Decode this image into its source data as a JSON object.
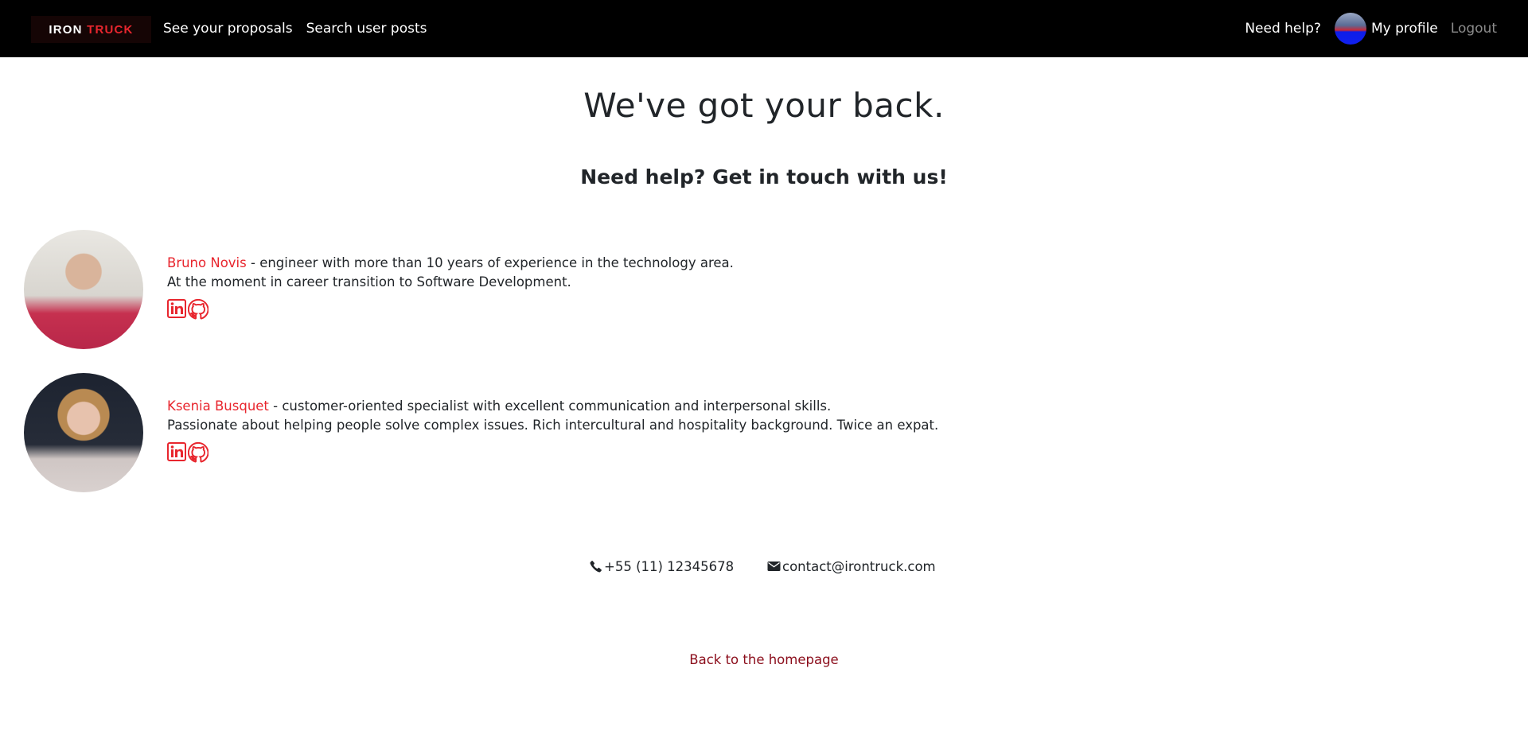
{
  "nav": {
    "brand_part1": "IRON",
    "brand_part2": "TRUCK",
    "proposals": "See your proposals",
    "search_posts": "Search user posts",
    "need_help": "Need help?",
    "my_profile": "My profile",
    "logout": "Logout"
  },
  "main": {
    "title": "We've got your back.",
    "subtitle": "Need help? Get in touch with us!"
  },
  "team": [
    {
      "name": "Bruno Novis",
      "line1": " - engineer with more than 10 years of experience in the technology area.",
      "line2": "At the moment in career transition to Software Development."
    },
    {
      "name": "Ksenia Busquet",
      "line1": " - customer-oriented specialist with excellent communication and interpersonal skills.",
      "line2": "Passionate about helping people solve complex issues. Rich intercultural and hospitality background. Twice an expat."
    }
  ],
  "contact": {
    "phone": "+55 (11) 12345678",
    "email": "contact@irontruck.com"
  },
  "footer": {
    "back_link": "Back to the homepage"
  },
  "colors": {
    "accent_red": "#e8262e",
    "dark_red_link": "#8b0d1b",
    "navbar_bg": "#000000"
  },
  "icons": [
    "phone-icon",
    "envelope-icon",
    "linkedin-icon",
    "github-icon"
  ]
}
